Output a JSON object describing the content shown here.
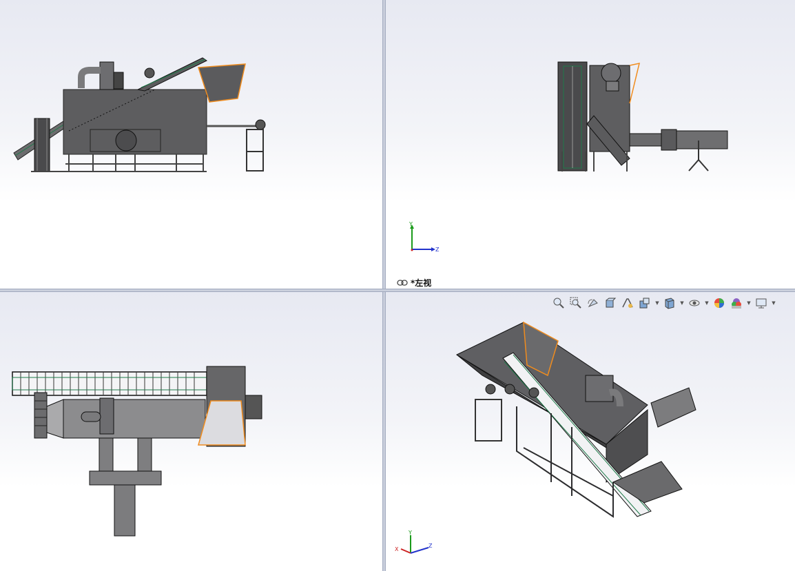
{
  "views": {
    "top_left": {
      "name": "front-view"
    },
    "top_right": {
      "name": "left-view",
      "label": "*左视"
    },
    "bottom_left": {
      "name": "top-view"
    },
    "bottom_right": {
      "name": "isometric-view"
    }
  },
  "triad": {
    "x": "X",
    "y": "Y",
    "z": "Z"
  },
  "toolbar": {
    "icons": [
      "zoom-to-fit-icon",
      "zoom-to-area-icon",
      "previous-view-icon",
      "section-view-icon",
      "dynamic-annotation-icon",
      "view-orientation-icon",
      "display-style-icon",
      "hide-show-items-icon",
      "edit-appearance-icon",
      "apply-scene-icon",
      "view-settings-icon"
    ]
  },
  "colors": {
    "highlight": "#f08c1e",
    "body": "#5e5e60",
    "frame": "#3a3a3c"
  }
}
